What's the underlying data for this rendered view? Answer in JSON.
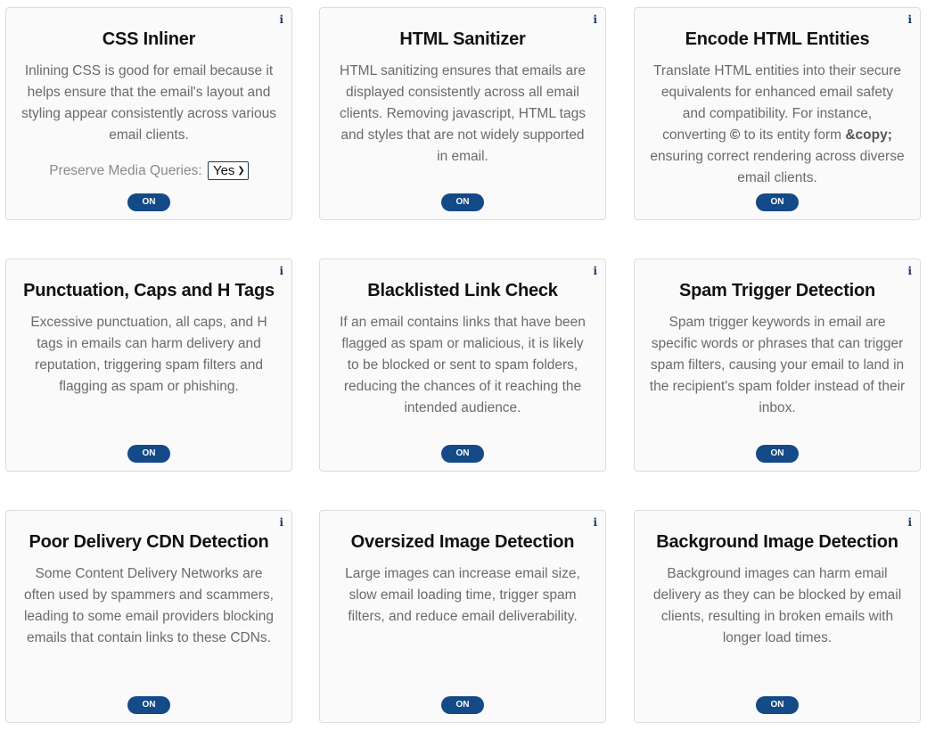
{
  "colors": {
    "toggle_bg": "#134a87",
    "title": "#111111",
    "description": "#6b6b6b",
    "info_icon": "#1d3a63",
    "card_bg": "#fafafa",
    "card_border": "#dcdcdc"
  },
  "icons": {
    "info": "info-icon"
  },
  "info_glyph": "i",
  "cards": [
    {
      "title": "CSS Inliner",
      "description": "Inlining CSS is good for email because it helps ensure that the email's layout and styling appear consistently across various email clients.",
      "preserve_label": "Preserve Media Queries:",
      "preserve_value": "Yes",
      "toggle": "ON"
    },
    {
      "title": "HTML Sanitizer",
      "description": "HTML sanitizing ensures that emails are displayed consistently across all email clients. Removing javascript, HTML tags and styles that are not widely supported in email.",
      "toggle": "ON"
    },
    {
      "title": "Encode HTML Entities",
      "description_parts": {
        "before": "Translate HTML entities into their secure equivalents for enhanced email safety and compatibility. For instance, converting ",
        "symbol": "©",
        "middle": " to its entity form ",
        "entity": "&copy;",
        "after": " ensuring correct rendering across diverse email clients."
      },
      "toggle": "ON"
    },
    {
      "title": "Punctuation, Caps and H Tags",
      "description": "Excessive punctuation, all caps, and H tags in emails can harm delivery and reputation, triggering spam filters and flagging as spam or phishing.",
      "toggle": "ON"
    },
    {
      "title": "Blacklisted Link Check",
      "description": "If an email contains links that have been flagged as spam or malicious, it is likely to be blocked or sent to spam folders, reducing the chances of it reaching the intended audience.",
      "toggle": "ON"
    },
    {
      "title": "Spam Trigger Detection",
      "description": "Spam trigger keywords in email are specific words or phrases that can trigger spam filters, causing your email to land in the recipient's spam folder instead of their inbox.",
      "toggle": "ON"
    },
    {
      "title": "Poor Delivery CDN Detection",
      "description": "Some Content Delivery Networks are often used by spammers and scammers, leading to some email providers blocking emails that contain links to these CDNs.",
      "toggle": "ON"
    },
    {
      "title": "Oversized Image Detection",
      "description": "Large images can increase email size, slow email loading time, trigger spam filters, and reduce email deliverability.",
      "toggle": "ON"
    },
    {
      "title": "Background Image Detection",
      "description": "Background images can harm email delivery as they can be blocked by email clients, resulting in broken emails with longer load times.",
      "toggle": "ON"
    }
  ]
}
